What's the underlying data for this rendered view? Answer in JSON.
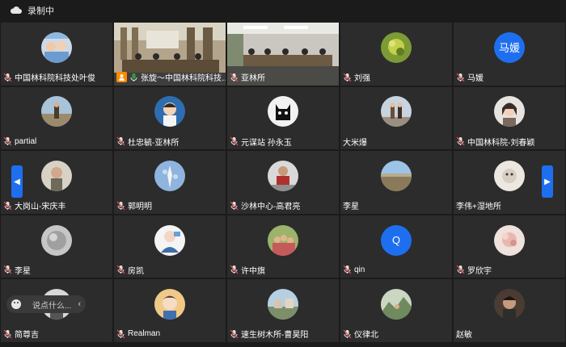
{
  "topbar": {
    "record_label": "录制中"
  },
  "chat": {
    "placeholder": "说点什么...",
    "collapse_icon": "chevron-left-icon",
    "emoji_icon": "smile-icon"
  },
  "navigation": {
    "prev_icon": "chevron-left-icon",
    "next_icon": "chevron-right-icon",
    "accent": "#1e6ff0"
  },
  "colors": {
    "background": "#1b1b1b",
    "tile": "#2c2c2c",
    "active_speaker": "#2ea043",
    "host_badge": "#ff8a00",
    "muted_mic": "#e0e0e0"
  },
  "participants": [
    {
      "name": "中国林科院科技处叶俊",
      "kind": "photo",
      "muted": true
    },
    {
      "name": "张旋～中国林科院科技…",
      "kind": "video",
      "muted": false,
      "host": true,
      "speaking": true
    },
    {
      "name": "亚林所",
      "kind": "video",
      "muted": true
    },
    {
      "name": "刘强",
      "kind": "photo",
      "muted": true
    },
    {
      "name": "马媛",
      "kind": "text",
      "avatar_text": "马媛",
      "muted": true
    },
    {
      "name": "partial",
      "kind": "photo",
      "muted": true
    },
    {
      "name": "杜忠毓-亚林所",
      "kind": "photo",
      "muted": true
    },
    {
      "name": "元谋站 孙永玉",
      "kind": "photo",
      "muted": true
    },
    {
      "name": "大米爆",
      "kind": "photo",
      "muted": false
    },
    {
      "name": "中国林科院-刘春颖",
      "kind": "photo",
      "muted": true
    },
    {
      "name": "大岗山-宋庆丰",
      "kind": "photo",
      "muted": true
    },
    {
      "name": "郭明明",
      "kind": "photo",
      "muted": true
    },
    {
      "name": "沙林中心-高君亮",
      "kind": "photo",
      "muted": true
    },
    {
      "name": "李星",
      "kind": "photo",
      "muted": false
    },
    {
      "name": "李伟+湿地所",
      "kind": "photo",
      "muted": false
    },
    {
      "name": "李星",
      "kind": "photo",
      "muted": true
    },
    {
      "name": "房凯",
      "kind": "photo",
      "muted": true
    },
    {
      "name": "许中旗",
      "kind": "photo",
      "muted": true
    },
    {
      "name": "qin",
      "kind": "text",
      "avatar_text": "Q",
      "muted": true
    },
    {
      "name": "罗欣宇",
      "kind": "photo",
      "muted": true
    },
    {
      "name": "简尊吉",
      "kind": "photo",
      "muted": true
    },
    {
      "name": "Realman",
      "kind": "photo",
      "muted": true
    },
    {
      "name": "速生树木所-曹昊阳",
      "kind": "photo",
      "muted": true
    },
    {
      "name": "仪律北",
      "kind": "photo",
      "muted": true
    },
    {
      "name": "赵敏",
      "kind": "photo",
      "muted": false
    }
  ]
}
